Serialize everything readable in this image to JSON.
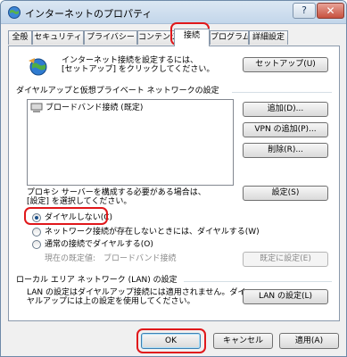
{
  "window": {
    "title": "インターネットのプロパティ",
    "help": "?",
    "close": "✕"
  },
  "tabs": [
    "全般",
    "セキュリティ",
    "プライバシー",
    "コンテンツ",
    "接続",
    "プログラム",
    "詳細設定"
  ],
  "setup": {
    "text_line1": "インターネット接続を設定するには、",
    "text_line2": "[セットアップ] をクリックしてください。",
    "button": "セットアップ(U)"
  },
  "dialup": {
    "section_title": "ダイヤルアップと仮想プライベート ネットワークの設定",
    "items": [
      "ブロードバンド接続 (既定)"
    ],
    "add_button": "追加(D)...",
    "add_vpn_button": "VPN の追加(P)...",
    "remove_button": "削除(R)...",
    "settings_button": "設定(S)",
    "proxy_note_line1": "プロキシ サーバーを構成する必要がある場合は、",
    "proxy_note_line2": "[設定] を選択してください。"
  },
  "options": {
    "never_dial": "ダイヤルしない(C)",
    "dial_when_no_network": "ネットワーク接続が存在しないときには、ダイヤルする(W)",
    "always_dial": "通常の接続でダイヤルする(O)",
    "selected": "never_dial"
  },
  "default": {
    "label": "現在の既定値:",
    "value": "ブロードバンド接続",
    "button": "既定に設定(E)"
  },
  "lan": {
    "section_title": "ローカル エリア ネットワーク (LAN) の設定",
    "text_line1": "LAN の設定はダイヤルアップ接続には適用されません。ダイ",
    "text_line2": "ヤルアップには上の設定を使用してください。",
    "button": "LAN の設定(L)"
  },
  "footer": {
    "ok": "OK",
    "cancel": "キャンセル",
    "apply": "適用(A)"
  },
  "colors": {
    "highlight": "#e0181b",
    "title_bg": "#c3d6ea"
  }
}
